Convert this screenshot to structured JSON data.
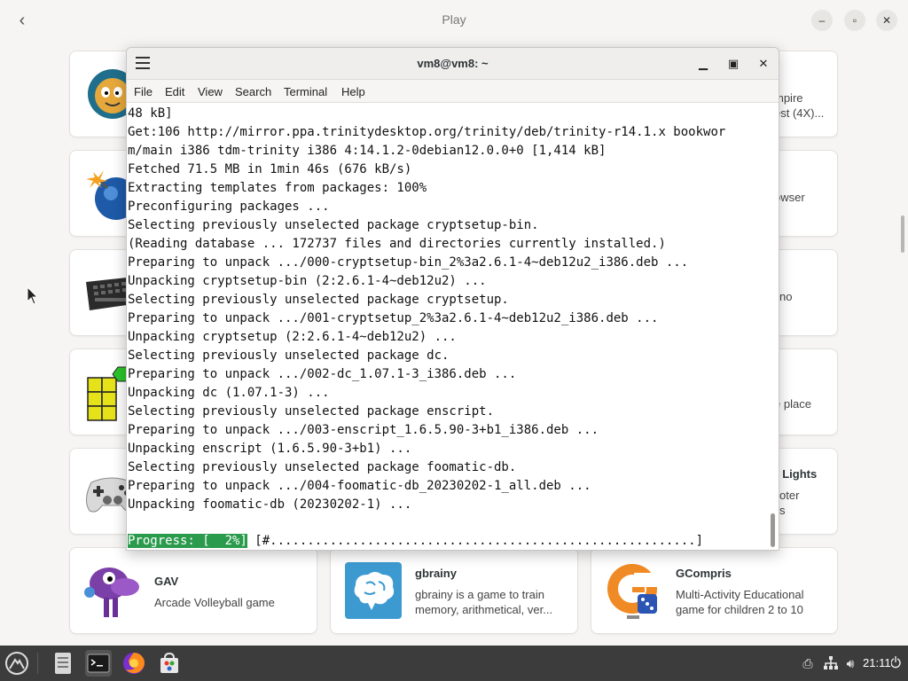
{
  "software_center": {
    "title": "Play",
    "cards_right": [
      {
        "desc_line1": "mpire",
        "desc_line2": "est (4X)..."
      },
      {
        "desc_line1": "owser",
        "desc_line2": ""
      },
      {
        "desc_line1": "no",
        "desc_line2": ""
      },
      {
        "desc_line1": "e place",
        "desc_line2": ""
      },
      {
        "title": "l Lights",
        "desc_line1": "oter",
        "desc_line2": "s"
      }
    ],
    "bottom_cards": [
      {
        "title": "GAV",
        "desc_line1": "Arcade Volleyball game",
        "desc_line2": ""
      },
      {
        "title": "gbrainy",
        "desc_line1": "gbrainy is a game to train",
        "desc_line2": "memory, arithmetical, ver..."
      },
      {
        "title": "GCompris",
        "desc_line1": "Multi-Activity Educational",
        "desc_line2": "game for children 2 to 10"
      }
    ]
  },
  "terminal": {
    "title": "vm8@vm8: ~",
    "menu": [
      "File",
      "Edit",
      "View",
      "Search",
      "Terminal",
      "Help"
    ],
    "lines": [
      "48 kB]",
      "Get:106 http://mirror.ppa.trinitydesktop.org/trinity/deb/trinity-r14.1.x bookwor",
      "m/main i386 tdm-trinity i386 4:14.1.2-0debian12.0.0+0 [1,414 kB]",
      "Fetched 71.5 MB in 1min 46s (676 kB/s)",
      "Extracting templates from packages: 100%",
      "Preconfiguring packages ...",
      "Selecting previously unselected package cryptsetup-bin.",
      "(Reading database ... 172737 files and directories currently installed.)",
      "Preparing to unpack .../000-cryptsetup-bin_2%3a2.6.1-4~deb12u2_i386.deb ...",
      "Unpacking cryptsetup-bin (2:2.6.1-4~deb12u2) ...",
      "Selecting previously unselected package cryptsetup.",
      "Preparing to unpack .../001-cryptsetup_2%3a2.6.1-4~deb12u2_i386.deb ...",
      "Unpacking cryptsetup (2:2.6.1-4~deb12u2) ...",
      "Selecting previously unselected package dc.",
      "Preparing to unpack .../002-dc_1.07.1-3_i386.deb ...",
      "Unpacking dc (1.07.1-3) ...",
      "Selecting previously unselected package enscript.",
      "Preparing to unpack .../003-enscript_1.6.5.90-3+b1_i386.deb ...",
      "Unpacking enscript (1.6.5.90-3+b1) ...",
      "Selecting previously unselected package foomatic-db.",
      "Preparing to unpack .../004-foomatic-db_20230202-1_all.deb ...",
      "Unpacking foomatic-db (20230202-1) ..."
    ],
    "progress_label": "Progress: [  2%]",
    "progress_bar": " [#.........................................................]",
    "progress_percent": 2
  },
  "taskbar": {
    "clock": "21:11"
  },
  "colors": {
    "progress_green": "#2a9a4c",
    "taskbar_bg": "#3c3c3c"
  }
}
